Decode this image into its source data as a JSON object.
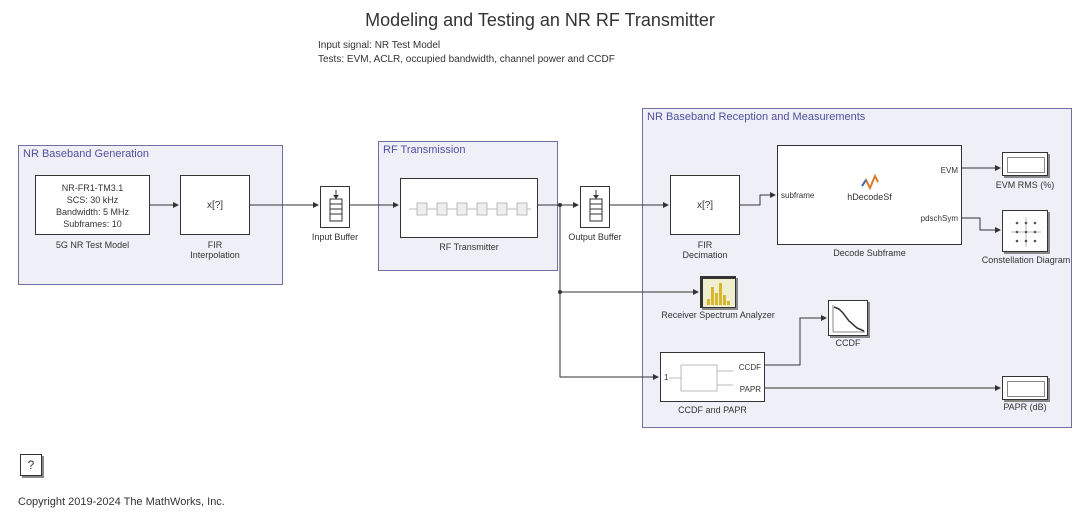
{
  "title": "Modeling and Testing an NR RF Transmitter",
  "subtitle1": "Input signal: NR Test Model",
  "subtitle2": "Tests: EVM, ACLR, occupied bandwidth, channel power and CCDF",
  "regions": {
    "gen": "NR Baseband Generation",
    "rf": "RF Transmission",
    "rx": "NR Baseband Reception and Measurements"
  },
  "blocks": {
    "test_model": {
      "line1": "NR-FR1-TM3.1",
      "line2": "SCS: 30 kHz",
      "line3": "Bandwidth: 5 MHz",
      "line4": "Subframes: 10",
      "label": "5G NR Test Model"
    },
    "fir_interp": {
      "text": "x[?]",
      "label": "FIR\nInterpolation"
    },
    "input_buf": {
      "label": "Input Buffer"
    },
    "rf_tx": {
      "label": "RF Transmitter"
    },
    "output_buf": {
      "label": "Output Buffer"
    },
    "fir_dec": {
      "text": "x[?]",
      "label": "FIR\nDecimation"
    },
    "decode": {
      "func": "hDecodeSf",
      "label": "Decode Subframe",
      "port_in": "subframe",
      "port_out1": "EVM",
      "port_out2": "pdschSym"
    },
    "evm_disp": {
      "label": "EVM RMS (%)"
    },
    "constel": {
      "label": "Constellation Diagram"
    },
    "specan": {
      "label": "Receiver Spectrum Analyzer"
    },
    "ccdf_papr": {
      "in": "1",
      "out1": "CCDF",
      "out2": "PAPR",
      "label": "CCDF and PAPR"
    },
    "ccdf_disp": {
      "label": "CCDF"
    },
    "papr_disp": {
      "label": "PAPR (dB)"
    }
  },
  "help": "?",
  "copyright": "Copyright 2019-2024 The MathWorks, Inc."
}
